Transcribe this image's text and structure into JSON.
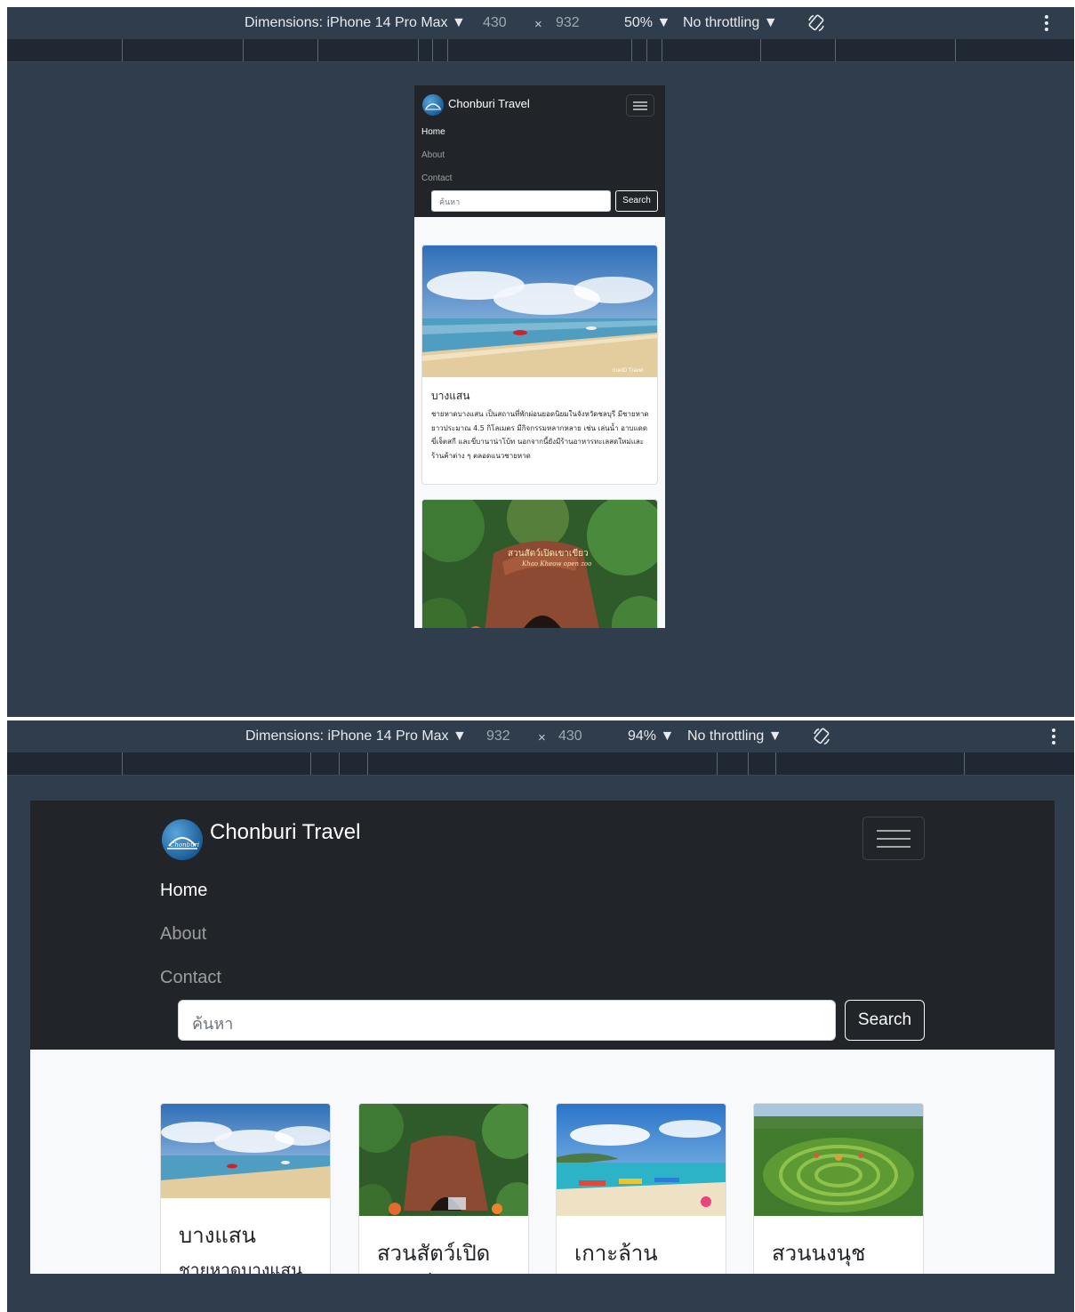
{
  "devtools": [
    {
      "dimensions_label": "Dimensions: iPhone 14 Pro Max ▼",
      "width": "430",
      "times": "×",
      "height": "932",
      "zoom": "50% ▼",
      "throttling": "No throttling ▼"
    },
    {
      "dimensions_label": "Dimensions: iPhone 14 Pro Max ▼",
      "width": "932",
      "times": "×",
      "height": "430",
      "zoom": "94% ▼",
      "throttling": "No throttling ▼"
    }
  ],
  "site": {
    "brand": "Chonburi Travel",
    "logo_text": "Chonburi",
    "nav": [
      "Home",
      "About",
      "Contact"
    ],
    "search_placeholder": "ค้นหา",
    "search_button": "Search",
    "cards": [
      {
        "title": "บางแสน",
        "text": "ชายหาดบางแสน เป็นสถานที่พักผ่อนยอดนิยมในจังหวัดชลบุรี มีชายหาดยาวประมาณ 4.5 กิโลเมตร มีกิจกรรมหลากหลาย เช่น เล่นน้ำ อาบแดด ขี่เจ็ตสกี และขี่บานาน่าโบ้ท นอกจากนี้ยังมีร้านอาหารทะเลสดใหม่และร้านค้าต่าง ๆ ตลอดแนวชายหาด",
        "text_short": "ชายหาดบางแสน",
        "watermark": "trueID Travel"
      },
      {
        "title": "สวนสัตว์เปิดเขาเขียว",
        "title_line1": "สวนสัตว์เปิด",
        "title_line2": "เขาเขียว",
        "sign_line1": "สวนสัตว์เปิดเขาเขียว",
        "sign_line2": "Khao Kheow open zoo"
      },
      {
        "title": "เกาะล้าน"
      },
      {
        "title": "สวนนงนุช"
      }
    ]
  },
  "colors": {
    "devtools_bg": "#2f3d4c",
    "ruler_bg": "#1f2833",
    "navbar_bg": "#212529",
    "content_bg": "#f8f9fa"
  }
}
